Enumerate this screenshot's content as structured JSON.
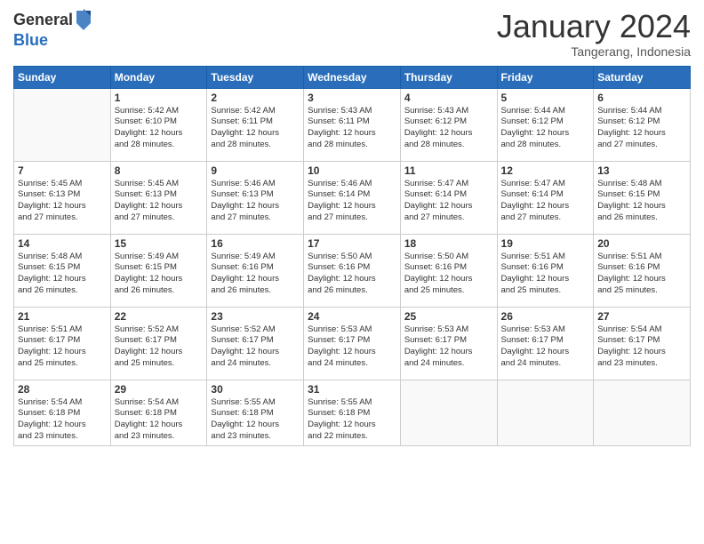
{
  "logo": {
    "general": "General",
    "blue": "Blue"
  },
  "title": "January 2024",
  "location": "Tangerang, Indonesia",
  "days_header": [
    "Sunday",
    "Monday",
    "Tuesday",
    "Wednesday",
    "Thursday",
    "Friday",
    "Saturday"
  ],
  "weeks": [
    [
      {
        "num": "",
        "sunrise": "",
        "sunset": "",
        "daylight": ""
      },
      {
        "num": "1",
        "sunrise": "Sunrise: 5:42 AM",
        "sunset": "Sunset: 6:10 PM",
        "daylight": "Daylight: 12 hours and 28 minutes."
      },
      {
        "num": "2",
        "sunrise": "Sunrise: 5:42 AM",
        "sunset": "Sunset: 6:11 PM",
        "daylight": "Daylight: 12 hours and 28 minutes."
      },
      {
        "num": "3",
        "sunrise": "Sunrise: 5:43 AM",
        "sunset": "Sunset: 6:11 PM",
        "daylight": "Daylight: 12 hours and 28 minutes."
      },
      {
        "num": "4",
        "sunrise": "Sunrise: 5:43 AM",
        "sunset": "Sunset: 6:12 PM",
        "daylight": "Daylight: 12 hours and 28 minutes."
      },
      {
        "num": "5",
        "sunrise": "Sunrise: 5:44 AM",
        "sunset": "Sunset: 6:12 PM",
        "daylight": "Daylight: 12 hours and 28 minutes."
      },
      {
        "num": "6",
        "sunrise": "Sunrise: 5:44 AM",
        "sunset": "Sunset: 6:12 PM",
        "daylight": "Daylight: 12 hours and 27 minutes."
      }
    ],
    [
      {
        "num": "7",
        "sunrise": "Sunrise: 5:45 AM",
        "sunset": "Sunset: 6:13 PM",
        "daylight": "Daylight: 12 hours and 27 minutes."
      },
      {
        "num": "8",
        "sunrise": "Sunrise: 5:45 AM",
        "sunset": "Sunset: 6:13 PM",
        "daylight": "Daylight: 12 hours and 27 minutes."
      },
      {
        "num": "9",
        "sunrise": "Sunrise: 5:46 AM",
        "sunset": "Sunset: 6:13 PM",
        "daylight": "Daylight: 12 hours and 27 minutes."
      },
      {
        "num": "10",
        "sunrise": "Sunrise: 5:46 AM",
        "sunset": "Sunset: 6:14 PM",
        "daylight": "Daylight: 12 hours and 27 minutes."
      },
      {
        "num": "11",
        "sunrise": "Sunrise: 5:47 AM",
        "sunset": "Sunset: 6:14 PM",
        "daylight": "Daylight: 12 hours and 27 minutes."
      },
      {
        "num": "12",
        "sunrise": "Sunrise: 5:47 AM",
        "sunset": "Sunset: 6:14 PM",
        "daylight": "Daylight: 12 hours and 27 minutes."
      },
      {
        "num": "13",
        "sunrise": "Sunrise: 5:48 AM",
        "sunset": "Sunset: 6:15 PM",
        "daylight": "Daylight: 12 hours and 26 minutes."
      }
    ],
    [
      {
        "num": "14",
        "sunrise": "Sunrise: 5:48 AM",
        "sunset": "Sunset: 6:15 PM",
        "daylight": "Daylight: 12 hours and 26 minutes."
      },
      {
        "num": "15",
        "sunrise": "Sunrise: 5:49 AM",
        "sunset": "Sunset: 6:15 PM",
        "daylight": "Daylight: 12 hours and 26 minutes."
      },
      {
        "num": "16",
        "sunrise": "Sunrise: 5:49 AM",
        "sunset": "Sunset: 6:16 PM",
        "daylight": "Daylight: 12 hours and 26 minutes."
      },
      {
        "num": "17",
        "sunrise": "Sunrise: 5:50 AM",
        "sunset": "Sunset: 6:16 PM",
        "daylight": "Daylight: 12 hours and 26 minutes."
      },
      {
        "num": "18",
        "sunrise": "Sunrise: 5:50 AM",
        "sunset": "Sunset: 6:16 PM",
        "daylight": "Daylight: 12 hours and 25 minutes."
      },
      {
        "num": "19",
        "sunrise": "Sunrise: 5:51 AM",
        "sunset": "Sunset: 6:16 PM",
        "daylight": "Daylight: 12 hours and 25 minutes."
      },
      {
        "num": "20",
        "sunrise": "Sunrise: 5:51 AM",
        "sunset": "Sunset: 6:16 PM",
        "daylight": "Daylight: 12 hours and 25 minutes."
      }
    ],
    [
      {
        "num": "21",
        "sunrise": "Sunrise: 5:51 AM",
        "sunset": "Sunset: 6:17 PM",
        "daylight": "Daylight: 12 hours and 25 minutes."
      },
      {
        "num": "22",
        "sunrise": "Sunrise: 5:52 AM",
        "sunset": "Sunset: 6:17 PM",
        "daylight": "Daylight: 12 hours and 25 minutes."
      },
      {
        "num": "23",
        "sunrise": "Sunrise: 5:52 AM",
        "sunset": "Sunset: 6:17 PM",
        "daylight": "Daylight: 12 hours and 24 minutes."
      },
      {
        "num": "24",
        "sunrise": "Sunrise: 5:53 AM",
        "sunset": "Sunset: 6:17 PM",
        "daylight": "Daylight: 12 hours and 24 minutes."
      },
      {
        "num": "25",
        "sunrise": "Sunrise: 5:53 AM",
        "sunset": "Sunset: 6:17 PM",
        "daylight": "Daylight: 12 hours and 24 minutes."
      },
      {
        "num": "26",
        "sunrise": "Sunrise: 5:53 AM",
        "sunset": "Sunset: 6:17 PM",
        "daylight": "Daylight: 12 hours and 24 minutes."
      },
      {
        "num": "27",
        "sunrise": "Sunrise: 5:54 AM",
        "sunset": "Sunset: 6:17 PM",
        "daylight": "Daylight: 12 hours and 23 minutes."
      }
    ],
    [
      {
        "num": "28",
        "sunrise": "Sunrise: 5:54 AM",
        "sunset": "Sunset: 6:18 PM",
        "daylight": "Daylight: 12 hours and 23 minutes."
      },
      {
        "num": "29",
        "sunrise": "Sunrise: 5:54 AM",
        "sunset": "Sunset: 6:18 PM",
        "daylight": "Daylight: 12 hours and 23 minutes."
      },
      {
        "num": "30",
        "sunrise": "Sunrise: 5:55 AM",
        "sunset": "Sunset: 6:18 PM",
        "daylight": "Daylight: 12 hours and 23 minutes."
      },
      {
        "num": "31",
        "sunrise": "Sunrise: 5:55 AM",
        "sunset": "Sunset: 6:18 PM",
        "daylight": "Daylight: 12 hours and 22 minutes."
      },
      {
        "num": "",
        "sunrise": "",
        "sunset": "",
        "daylight": ""
      },
      {
        "num": "",
        "sunrise": "",
        "sunset": "",
        "daylight": ""
      },
      {
        "num": "",
        "sunrise": "",
        "sunset": "",
        "daylight": ""
      }
    ]
  ]
}
